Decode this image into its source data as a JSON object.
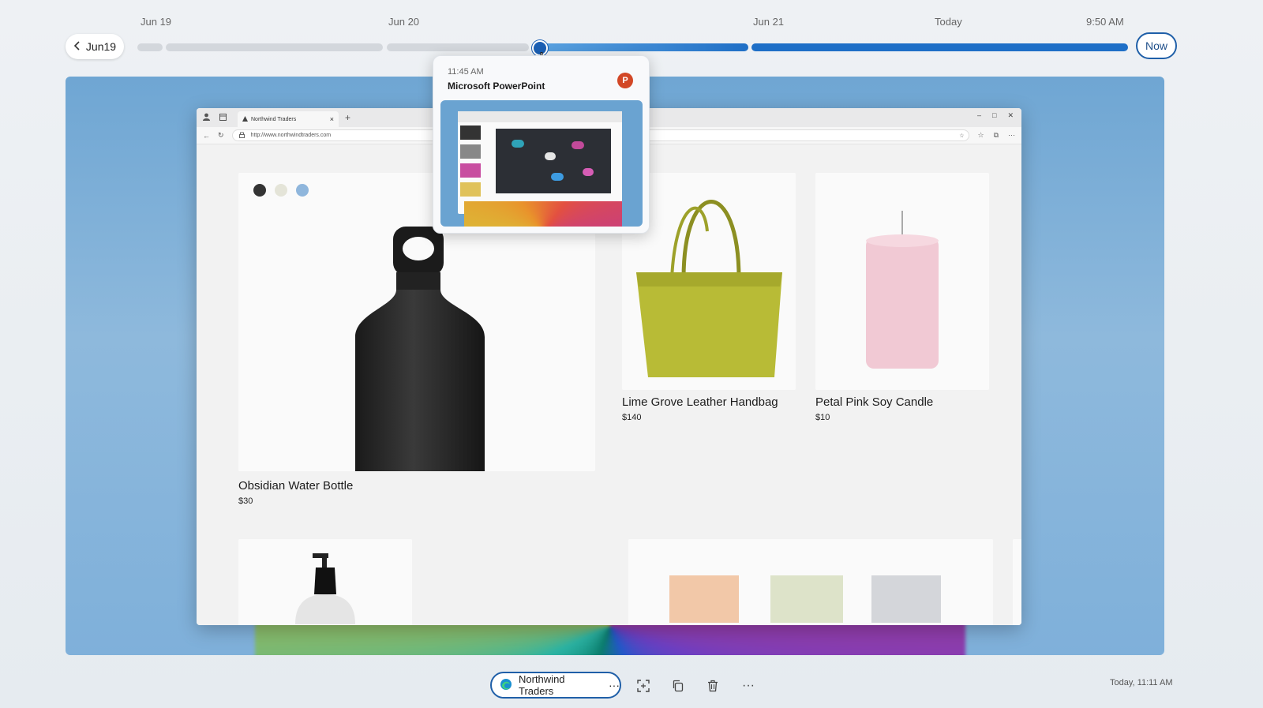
{
  "timeline": {
    "back_label": "Jun19",
    "date_labels": [
      "Jun 19",
      "Jun 20",
      "Jun 21",
      "Today",
      "9:50 AM"
    ],
    "now_label": "Now"
  },
  "popup": {
    "time": "11:45 AM",
    "app_name": "Microsoft PowerPoint",
    "app_icon": "powerpoint-icon",
    "app_badge": "P"
  },
  "browser": {
    "tab_title": "Northwind Traders",
    "url": "http://www.northwindtraders.com"
  },
  "products": [
    {
      "name": "Obsidian  Water Bottle",
      "price": "$30"
    },
    {
      "name": "Lime Grove Leather Handbag",
      "price": "$140"
    },
    {
      "name": "Petal Pink Soy Candle",
      "price": "$10"
    }
  ],
  "swatches": [
    "#333333",
    "#e4e4d8",
    "#8fb6dc"
  ],
  "bottom_bar": {
    "app_label": "Northwind Traders",
    "timestamp": "Today, 11:11 AM"
  },
  "colors": {
    "accent": "#1f5fa8",
    "timeline_blue": "#1e6fc7"
  }
}
